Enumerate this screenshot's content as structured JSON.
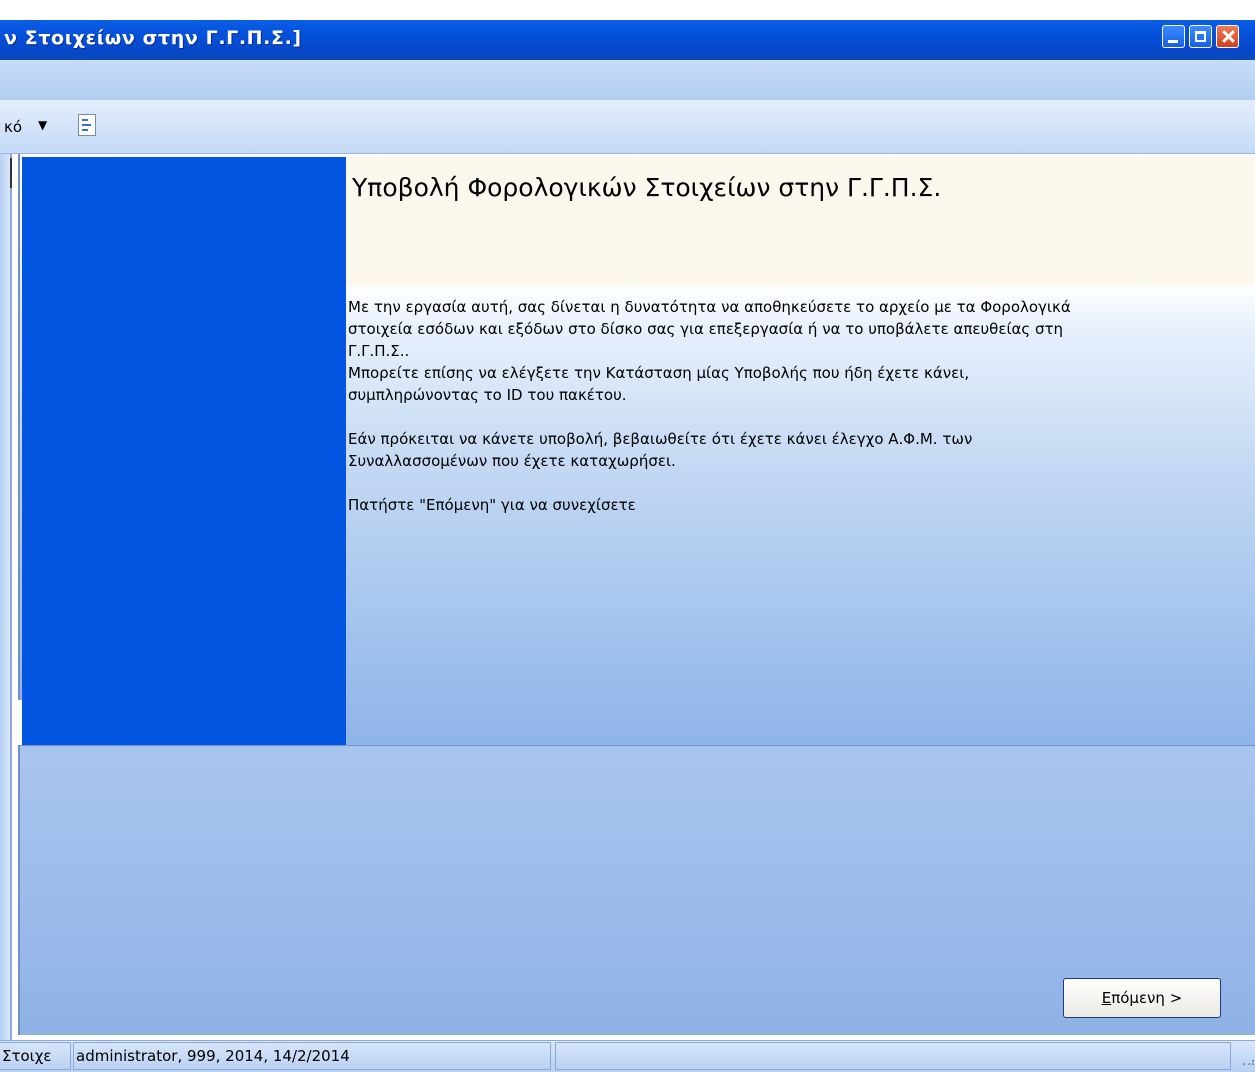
{
  "window": {
    "title": "ν Στοιχείων στην Γ.Γ.Π.Σ.]"
  },
  "toolbar": {
    "label": "κό",
    "dropdown_icon": "chevron-down-icon",
    "document_icon": "document-icon"
  },
  "wizard": {
    "title": "Υποβολή Φορολογικών Στοιχείων στην Γ.Γ.Π.Σ.",
    "paragraphs": [
      "Με την εργασία αυτή, σας δίνεται η δυνατότητα να αποθηκεύσετε το αρχείο με τα Φορολογικά",
      "στοιχεία εσόδων και εξόδων στο δίσκο σας για επεξεργασία ή να το υποβάλετε απευθείας στη",
      "Γ.Γ.Π.Σ..",
      "Μπορείτε επίσης να ελέγξετε την Κατάσταση μίας Υποβολής που ήδη έχετε κάνει,",
      "συμπληρώνοντας το ID του πακέτου.",
      "",
      "Εάν πρόκειται να κάνετε υποβολή, βεβαιωθείτε ότι έχετε κάνει έλεγχο Α.Φ.Μ. των",
      "Συναλλασσομένων που έχετε καταχωρήσει.",
      "",
      "Πατήστε \"Επόμενη\" για να συνεχίσετε"
    ],
    "next_button_mnemonic": "Ε",
    "next_button_rest": "πόμενη >"
  },
  "statusbar": {
    "cell1": "Στοιχε",
    "cell2": "administrator, 999, 2014, 14/2/2014",
    "cell3": ""
  }
}
